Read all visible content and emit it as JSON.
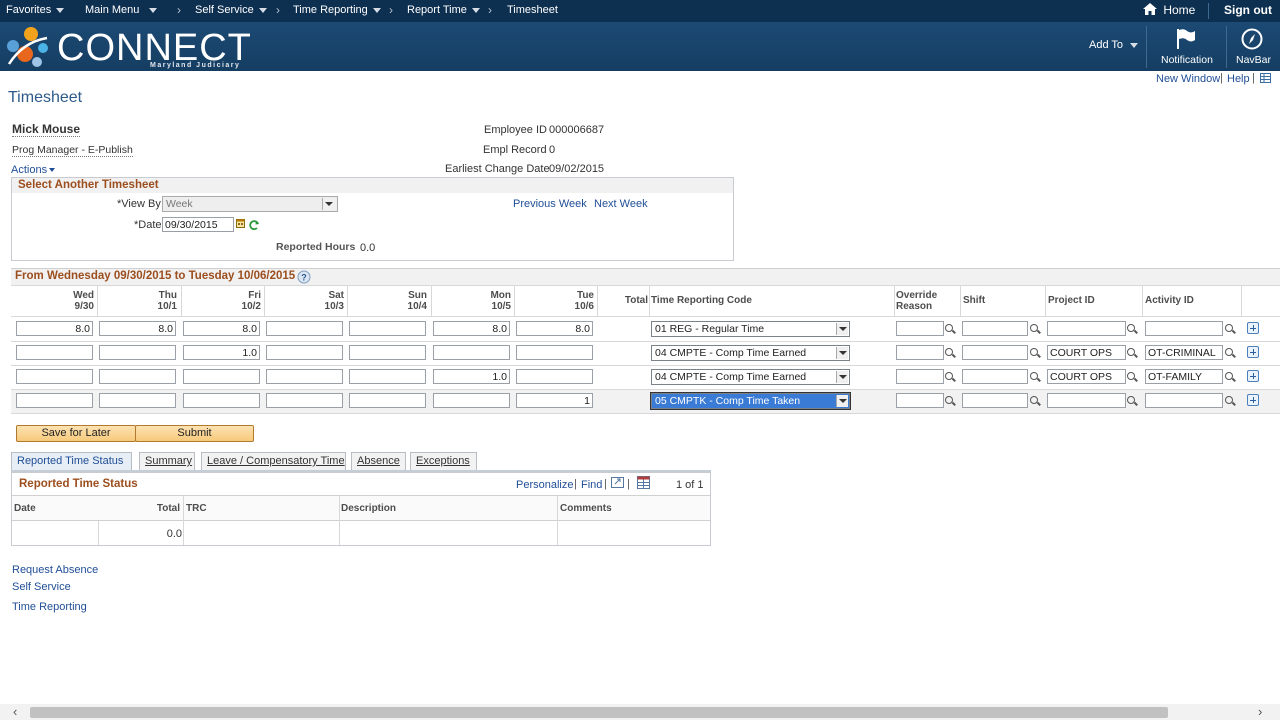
{
  "nav": {
    "favorites": "Favorites",
    "main_menu": "Main Menu",
    "self_service": "Self Service",
    "time_reporting": "Time Reporting",
    "report_time": "Report Time",
    "current": "Timesheet",
    "home": "Home",
    "sign_out": "Sign out"
  },
  "banner": {
    "logo_text": "CONNECT",
    "logo_sub": "Maryland Judiciary",
    "add_to": "Add To",
    "notification": "Notification",
    "navbar": "NavBar"
  },
  "utility": {
    "new_window": "New Window",
    "help": "Help"
  },
  "page": {
    "title": "Timesheet"
  },
  "employee": {
    "name": "Mick Mouse",
    "job_title": "Prog Manager - E-Publish",
    "actions": "Actions",
    "employee_id_label": "Employee ID",
    "employee_id": "000006687",
    "empl_record_label": "Empl Record",
    "empl_record": "0",
    "earliest_change_label": "Earliest Change Date",
    "earliest_change": "09/02/2015"
  },
  "select_timesheet": {
    "title": "Select Another Timesheet",
    "view_by_label": "*View By",
    "view_by": "Week",
    "date_label": "*Date",
    "date": "09/30/2015",
    "previous_week": "Previous Week",
    "next_week": "Next Week",
    "reported_hours_label": "Reported Hours",
    "reported_hours": "0.0"
  },
  "timesheet": {
    "period_title": "From Wednesday 09/30/2015 to Tuesday 10/06/2015",
    "days": [
      {
        "day": "Wed",
        "date": "9/30"
      },
      {
        "day": "Thu",
        "date": "10/1"
      },
      {
        "day": "Fri",
        "date": "10/2"
      },
      {
        "day": "Sat",
        "date": "10/3"
      },
      {
        "day": "Sun",
        "date": "10/4"
      },
      {
        "day": "Mon",
        "date": "10/5"
      },
      {
        "day": "Tue",
        "date": "10/6"
      }
    ],
    "headers": {
      "total": "Total",
      "trc": "Time Reporting Code",
      "override_1": "Override",
      "override_2": "Reason",
      "shift": "Shift",
      "project_id": "Project ID",
      "activity_id": "Activity ID"
    },
    "rows": [
      {
        "hours": [
          "8.0",
          "8.0",
          "8.0",
          "",
          "",
          "8.0",
          "8.0"
        ],
        "trc": "01 REG - Regular Time",
        "override": "",
        "shift": "",
        "project": "",
        "activity": ""
      },
      {
        "hours": [
          "",
          "",
          "1.0",
          "",
          "",
          "",
          ""
        ],
        "trc": "04 CMPTE - Comp Time Earned",
        "override": "",
        "shift": "",
        "project": "COURT OPS",
        "activity": "OT-CRIMINAL"
      },
      {
        "hours": [
          "",
          "",
          "",
          "",
          "",
          "1.0",
          ""
        ],
        "trc": "04 CMPTE - Comp Time Earned",
        "override": "",
        "shift": "",
        "project": "COURT OPS",
        "activity": "OT-FAMILY"
      },
      {
        "hours": [
          "",
          "",
          "",
          "",
          "",
          "",
          "1"
        ],
        "trc": "05 CMPTK - Comp Time Taken",
        "override": "",
        "shift": "",
        "project": "",
        "activity": ""
      }
    ]
  },
  "buttons": {
    "save_for_later": "Save for Later",
    "submit": "Submit"
  },
  "tabs": [
    {
      "label": "Reported Time Status"
    },
    {
      "label": "Summary"
    },
    {
      "label": "Leave / Compensatory Time"
    },
    {
      "label": "Absence"
    },
    {
      "label": "Exceptions"
    }
  ],
  "reported_status": {
    "title": "Reported Time Status",
    "personalize": "Personalize",
    "find": "Find",
    "pager": "1 of 1",
    "columns": {
      "date": "Date",
      "total": "Total",
      "trc": "TRC",
      "description": "Description",
      "comments": "Comments"
    },
    "row": {
      "date": "",
      "total": "0.0",
      "trc": "",
      "description": "",
      "comments": ""
    }
  },
  "bottom_links": {
    "request_absence": "Request Absence",
    "self_service": "Self Service",
    "time_reporting": "Time Reporting"
  },
  "colors": {
    "header_bg": "#0d2f50",
    "banner_bg": "#1c4a74",
    "link": "#1f4e96",
    "section_title": "#9c4e1e",
    "button": "#f7c97b"
  }
}
